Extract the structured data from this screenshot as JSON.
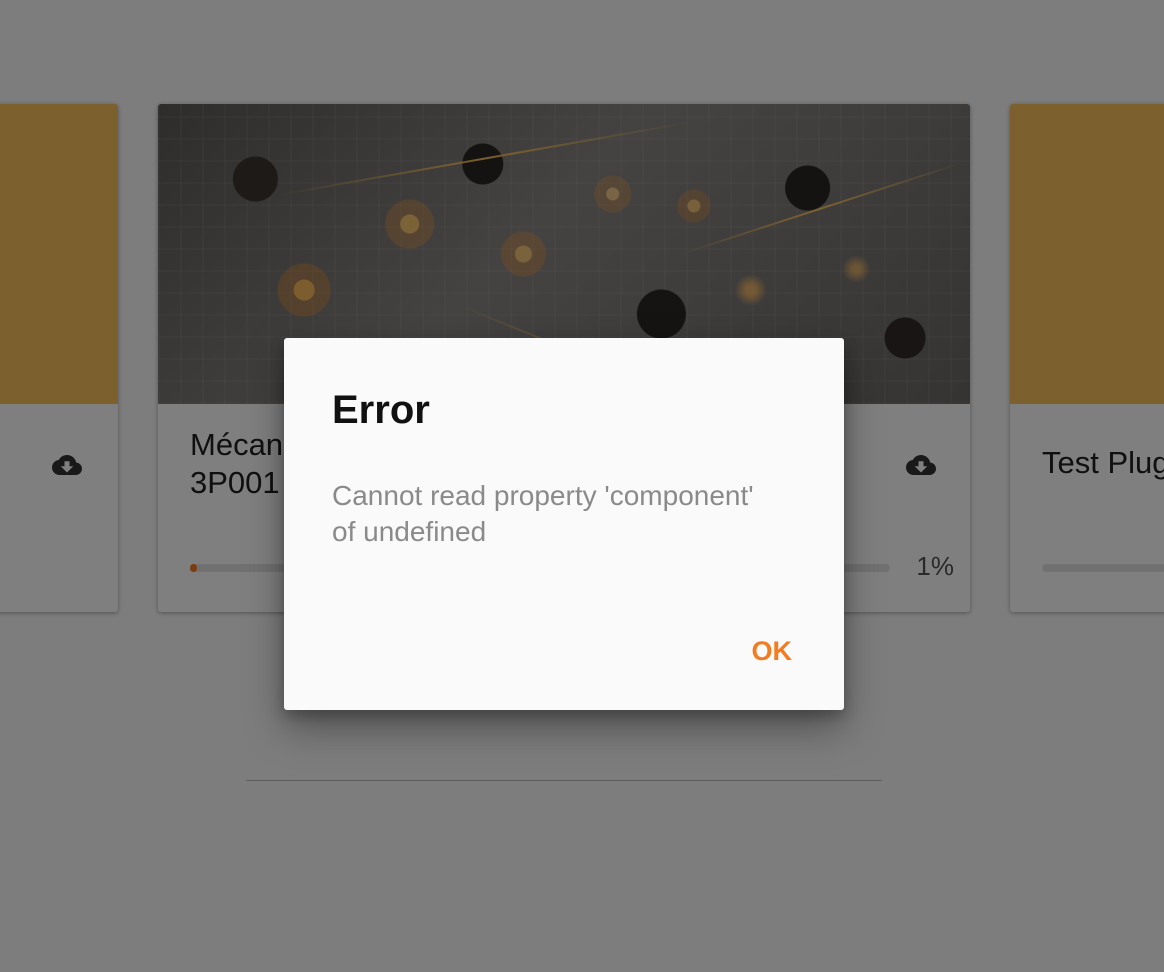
{
  "cards": {
    "left": {
      "title": "",
      "media_color": "#f9c15a",
      "icon": "cloud-download-icon"
    },
    "center": {
      "title_line1": "Mécan",
      "title_line2": "3P001",
      "media": "optics-lab-photo",
      "icon": "cloud-download-icon",
      "progress_percent": 1,
      "progress_label": "1%"
    },
    "right": {
      "title": "Test Plug",
      "media_color": "#f9c15a"
    }
  },
  "dialog": {
    "title": "Error",
    "message_line1": "Cannot read property 'component'",
    "message_line2": "of undefined",
    "ok_label": "OK"
  },
  "colors": {
    "accent": "#f47b20",
    "amber_media": "#f9c15a",
    "scrim": "rgba(0,0,0,0.5)"
  }
}
